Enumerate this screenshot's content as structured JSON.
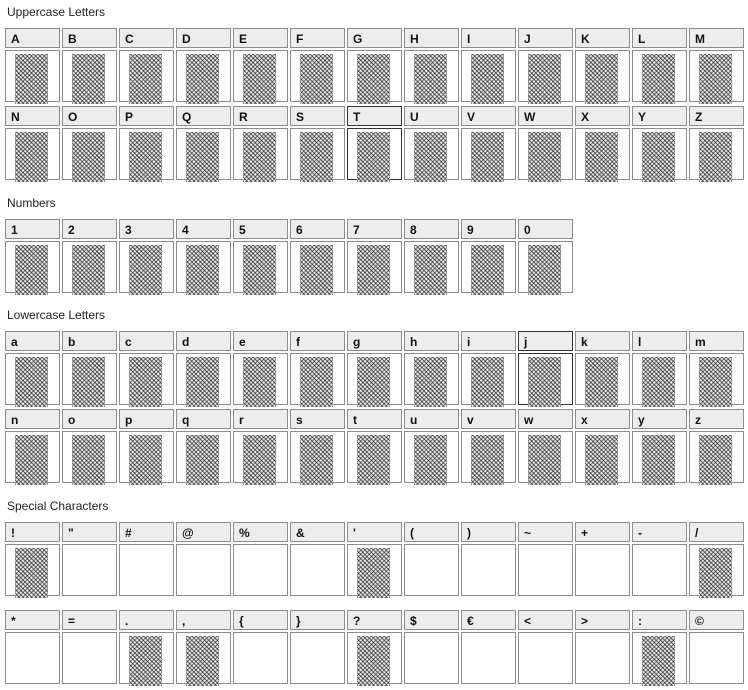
{
  "sections": [
    {
      "title": "Uppercase Letters",
      "rows": [
        [
          "A",
          "B",
          "C",
          "D",
          "E",
          "F",
          "G",
          "H",
          "I",
          "J",
          "K",
          "L",
          "M"
        ],
        [
          "N",
          "O",
          "P",
          "Q",
          "R",
          "S",
          "T",
          "U",
          "V",
          "W",
          "X",
          "Y",
          "Z"
        ]
      ],
      "highlight": [
        "T"
      ]
    },
    {
      "title": "Numbers",
      "rows": [
        [
          "1",
          "2",
          "3",
          "4",
          "5",
          "6",
          "7",
          "8",
          "9",
          "0"
        ]
      ],
      "highlight": []
    },
    {
      "title": "Lowercase Letters",
      "rows": [
        [
          "a",
          "b",
          "c",
          "d",
          "e",
          "f",
          "g",
          "h",
          "i",
          "j",
          "k",
          "l",
          "m"
        ],
        [
          "n",
          "o",
          "p",
          "q",
          "r",
          "s",
          "t",
          "u",
          "v",
          "w",
          "x",
          "y",
          "z"
        ]
      ],
      "highlight": [
        "j"
      ]
    },
    {
      "title": "Special Characters",
      "rows": [
        [
          "!",
          "\"",
          "#",
          "@",
          "%",
          "&",
          "'",
          "(",
          ")",
          "~",
          "+",
          "-",
          "/"
        ],
        [
          "*",
          "=",
          ".",
          ",",
          "{",
          "}",
          "?",
          "$",
          "€",
          "<",
          ">",
          ":",
          "©"
        ]
      ],
      "highlight": [],
      "with_glyph": [
        "!",
        "'",
        "/",
        ".",
        ",",
        "?",
        ":"
      ]
    }
  ]
}
